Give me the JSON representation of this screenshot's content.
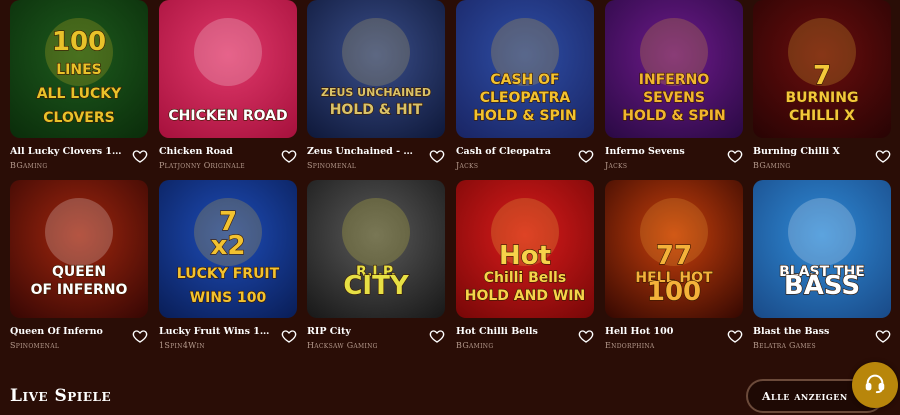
{
  "games": [
    {
      "title": "All Lucky Clovers 100",
      "provider": "BGaming",
      "art": [
        "100",
        "LINES",
        "ALL LUCKY",
        "CLOVERS"
      ],
      "bg": [
        "#1d5a1d",
        "#0b2e0b"
      ],
      "accent": "#e8c22a"
    },
    {
      "title": "Chicken Road",
      "provider": "Platjonny Originale",
      "art": [
        "CHICKEN ROAD"
      ],
      "bg": [
        "#e0386a",
        "#a8123e"
      ],
      "accent": "#ffffff"
    },
    {
      "title": "Zeus Unchained - Hold ...",
      "provider": "Spinomenal",
      "art": [
        "ZEUS UNCHAINED",
        "HOLD & HIT"
      ],
      "bg": [
        "#3a4e8a",
        "#101a3c"
      ],
      "accent": "#d9c36a"
    },
    {
      "title": "Cash of Cleopatra",
      "provider": "Jacks",
      "art": [
        "CASH OF",
        "CLEOPATRA",
        "HOLD & SPIN"
      ],
      "bg": [
        "#2e4ea6",
        "#1a2666"
      ],
      "accent": "#f2c230"
    },
    {
      "title": "Inferno Sevens",
      "provider": "Jacks",
      "art": [
        "INFERNO",
        "SEVENS",
        "HOLD & SPIN"
      ],
      "bg": [
        "#6d1a8a",
        "#2c0a46"
      ],
      "accent": "#f2b530"
    },
    {
      "title": "Burning Chilli X",
      "provider": "BGaming",
      "art": [
        "7",
        "BURNING",
        "CHILLI X"
      ],
      "bg": [
        "#6a0d0d",
        "#2a0404"
      ],
      "accent": "#f3c83a"
    },
    {
      "title": "Queen Of Inferno",
      "provider": "Spinomenal",
      "art": [
        "QUEEN",
        "OF INFERNO"
      ],
      "bg": [
        "#a0260e",
        "#3a0804"
      ],
      "accent": "#ffffff"
    },
    {
      "title": "Lucky Fruit Wins 100",
      "provider": "1Spin4Win",
      "art": [
        "7",
        "x2",
        "LUCKY FRUIT",
        "WINS 100"
      ],
      "bg": [
        "#1e4db8",
        "#0a1f5a"
      ],
      "accent": "#f2c230"
    },
    {
      "title": "RIP City",
      "provider": "Hacksaw Gaming",
      "art": [
        "R.I.P.",
        "CITY"
      ],
      "bg": [
        "#5a5a5a",
        "#1a1a1a"
      ],
      "accent": "#e7e045"
    },
    {
      "title": "Hot Chilli Bells",
      "provider": "BGaming",
      "art": [
        "Hot",
        "Chilli Bells",
        "HOLD AND WIN"
      ],
      "bg": [
        "#d81b1b",
        "#7a0808"
      ],
      "accent": "#f7d34a"
    },
    {
      "title": "Hell Hot 100",
      "provider": "Endorphina",
      "art": [
        "77",
        "HELL HOT",
        "100"
      ],
      "bg": [
        "#c8400c",
        "#3a0a02"
      ],
      "accent": "#f4b23a"
    },
    {
      "title": "Blast the Bass",
      "provider": "Belatra Games",
      "art": [
        "BLAST THE",
        "BASS"
      ],
      "bg": [
        "#2f8ad6",
        "#1a4c8a"
      ],
      "accent": "#ffffff"
    }
  ],
  "section": {
    "title": "Live Spiele",
    "show_all": "Alle anzeigen"
  },
  "icons": {
    "favorite": "heart-outline-icon",
    "support": "headset-icon"
  },
  "colors": {
    "background": "#2a0d06",
    "provider_text": "#b59a8d",
    "support_button": "#b8860b"
  }
}
